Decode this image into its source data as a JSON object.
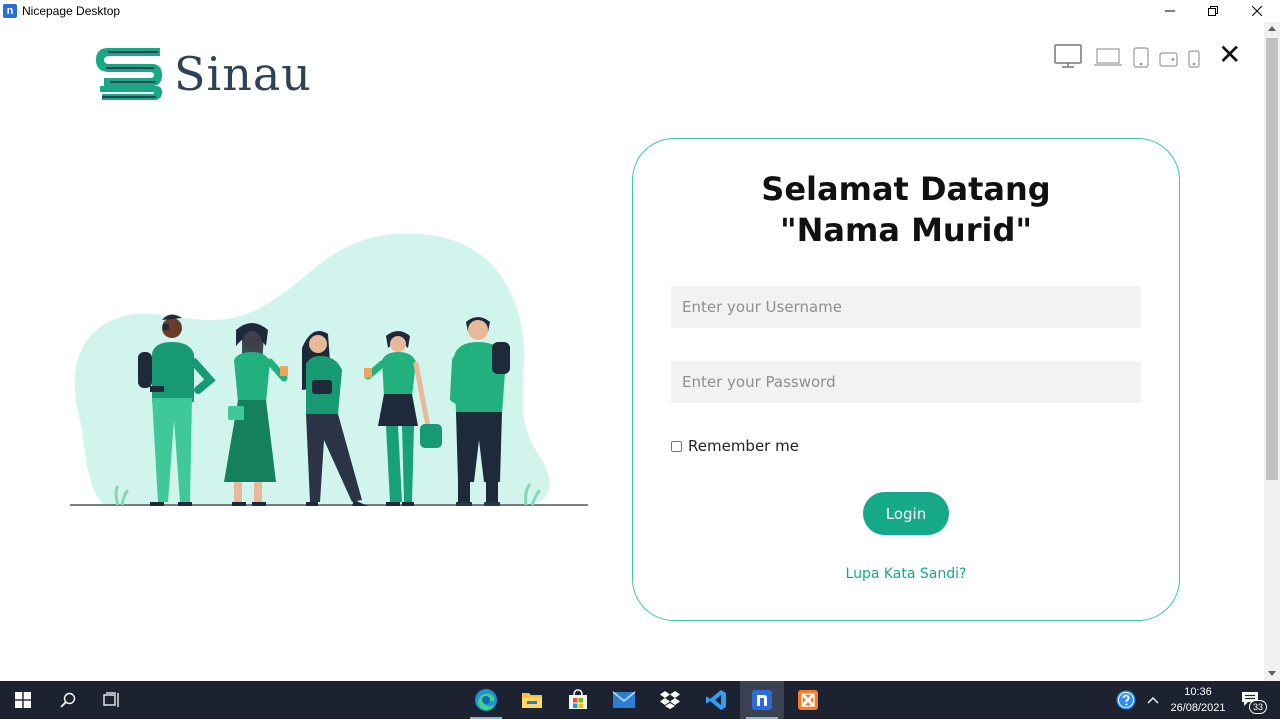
{
  "window": {
    "title": "Nicepage Desktop",
    "app_icon_letter": "n"
  },
  "brand": {
    "name": "Sinau",
    "accent": "#15a98a",
    "dark": "#2d4257"
  },
  "device_toolbar": {
    "icons": [
      "desktop-icon",
      "laptop-icon",
      "tablet-portrait-icon",
      "tablet-landscape-icon",
      "phone-icon"
    ],
    "close_glyph": "✕"
  },
  "login": {
    "heading_line1": "Selamat Datang",
    "heading_line2": "\"Nama Murid\"",
    "username_placeholder": "Enter your Username",
    "password_placeholder": "Enter your Password",
    "remember_label": "Remember me",
    "login_label": "Login",
    "forgot_label": "Lupa Kata Sandi?"
  },
  "taskbar": {
    "pinned": [
      "edge-icon",
      "file-explorer-icon",
      "microsoft-store-icon",
      "mail-icon",
      "dropbox-icon",
      "visual-studio-code-icon",
      "nicepage-icon",
      "xampp-icon"
    ],
    "time": "10:36",
    "date": "26/08/2021",
    "notification_count": "33"
  }
}
